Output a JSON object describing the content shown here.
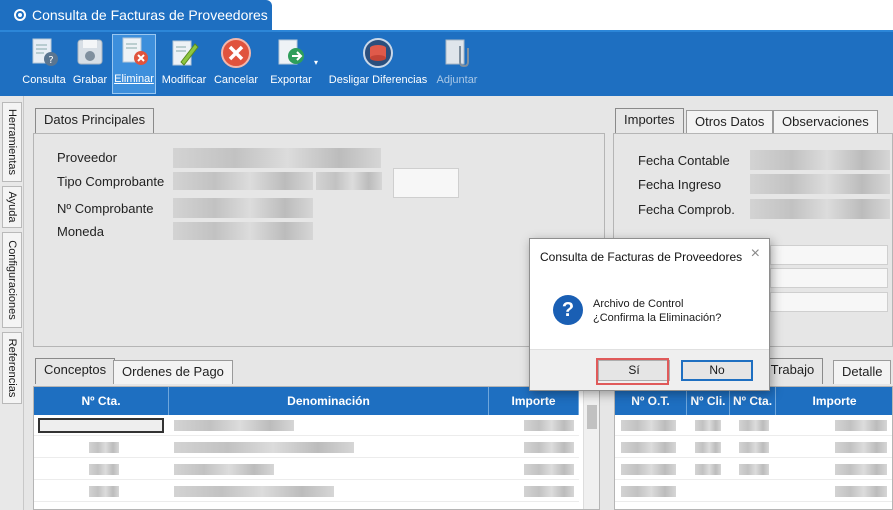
{
  "window": {
    "title": "Consulta de Facturas de Proveedores"
  },
  "toolbar": {
    "items": [
      {
        "label": "Consulta",
        "icon": "document-query-icon"
      },
      {
        "label": "Grabar",
        "icon": "save-disk-icon"
      },
      {
        "label": "Eliminar",
        "icon": "delete-document-icon"
      },
      {
        "label": "Modificar",
        "icon": "edit-pencil-icon"
      },
      {
        "label": "Cancelar",
        "icon": "cancel-x-icon"
      },
      {
        "label": "Exportar",
        "icon": "export-icon"
      },
      {
        "label": "Desligar Diferencias",
        "icon": "unlink-database-icon"
      },
      {
        "label": "Adjuntar",
        "icon": "attach-paperclip-icon"
      }
    ]
  },
  "side_tabs": [
    "Herramientas",
    "Ayuda",
    "Configuraciones",
    "Referencias"
  ],
  "datos": {
    "tab": "Datos Principales",
    "fields": {
      "proveedor": "Proveedor",
      "tipo": "Tipo Comprobante",
      "numero": "Nº Comprobante",
      "moneda": "Moneda"
    }
  },
  "importes": {
    "tabs": [
      "Importes",
      "Otros Datos",
      "Observaciones"
    ],
    "fields": {
      "contable": "Fecha Contable",
      "ingreso": "Fecha Ingreso",
      "comprob": "Fecha Comprob."
    }
  },
  "conceptos": {
    "tabs": [
      "Conceptos",
      "Ordenes de Pago"
    ],
    "columns": [
      "Nº Cta.",
      "Denominación",
      "Importe"
    ]
  },
  "ot": {
    "tabs": [
      "e Trabajo",
      "Detalle"
    ],
    "columns": [
      "Nº O.T.",
      "Nº Cli.",
      "Nº Cta.",
      "Importe"
    ]
  },
  "dialog": {
    "title": "Consulta de Facturas de Proveedores",
    "line1": "Archivo de Control",
    "line2": "¿Confirma la Eliminación?",
    "yes": "Sí",
    "no": "No"
  }
}
